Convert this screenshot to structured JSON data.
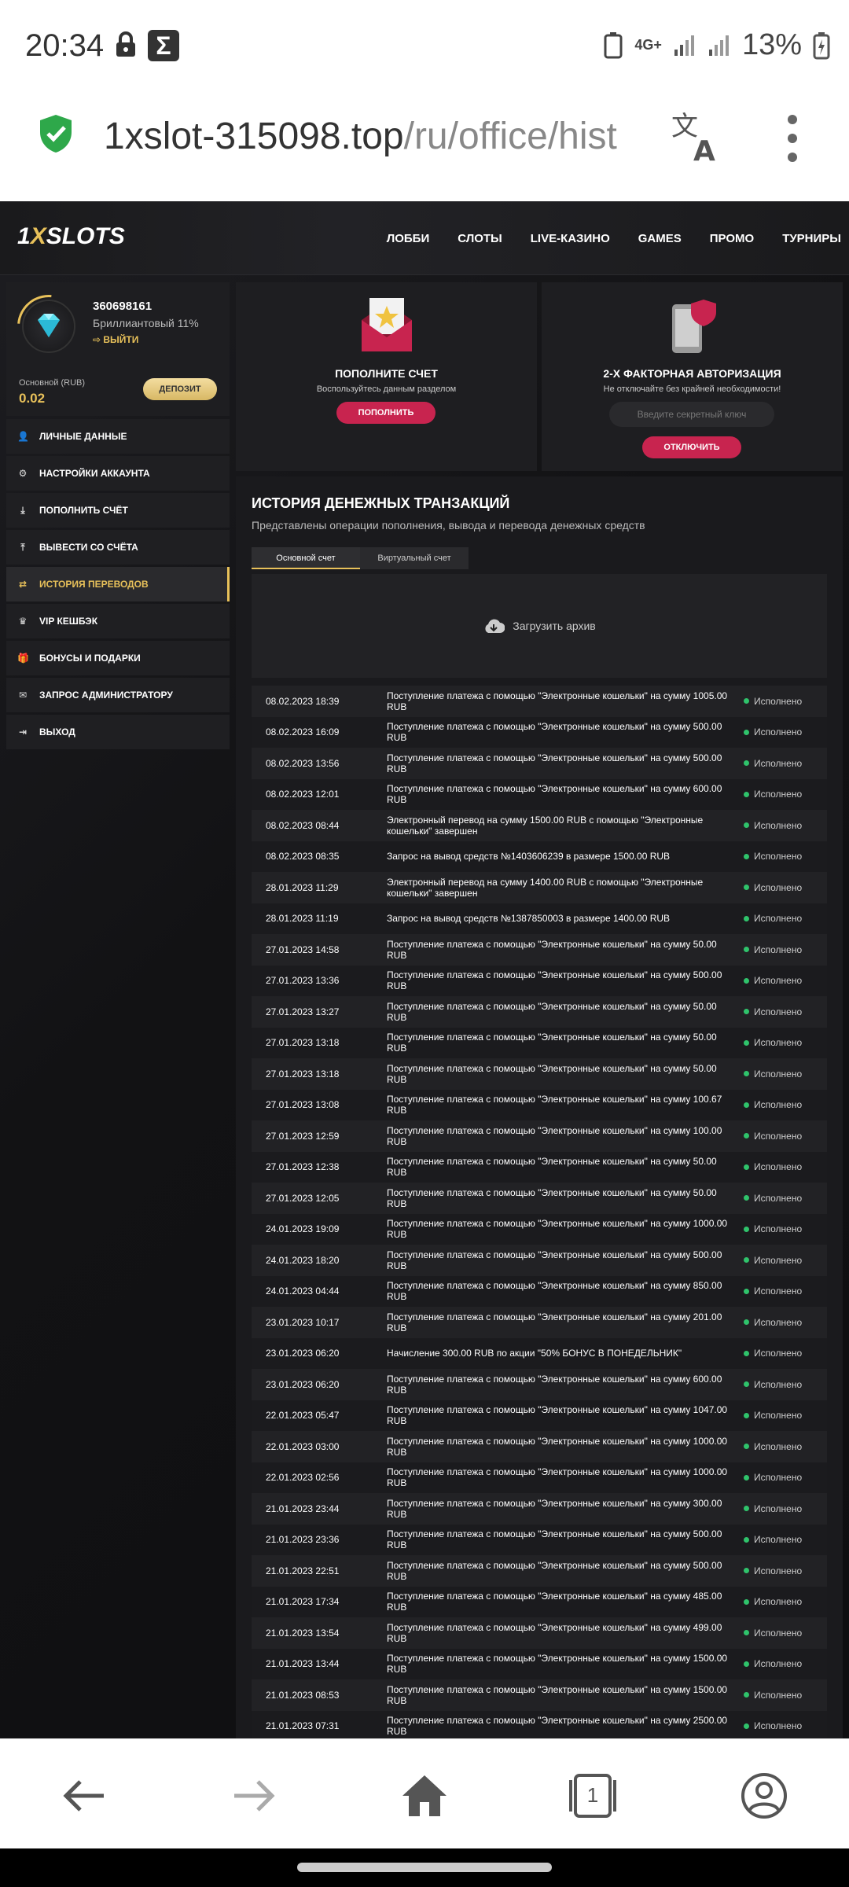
{
  "status": {
    "time": "20:34",
    "network": "4G+",
    "battery": "13%"
  },
  "browser": {
    "url_host": "1xslot-315098.top",
    "url_path": "/ru/office/hist",
    "tab_count": "1"
  },
  "site": {
    "logo_a": "1",
    "logo_x": "X",
    "logo_b": "SLOTS",
    "nav": [
      "ЛОББИ",
      "СЛОТЫ",
      "LIVE-КАЗИНО",
      "GAMES",
      "ПРОМО",
      "ТУРНИРЫ"
    ]
  },
  "profile": {
    "id": "360698161",
    "level": "Бриллиантовый 11%",
    "logout": "ВЫЙТИ",
    "balance_label": "Основной (RUB)",
    "balance": "0.02",
    "deposit_button": "ДЕПОЗИТ"
  },
  "sidebar": {
    "items": [
      {
        "label": "ЛИЧНЫЕ ДАННЫЕ",
        "icon": "user-plus-icon"
      },
      {
        "label": "НАСТРОЙКИ АККАУНТА",
        "icon": "gears-icon"
      },
      {
        "label": "ПОПОЛНИТЬ СЧЁТ",
        "icon": "download-icon"
      },
      {
        "label": "ВЫВЕСТИ СО СЧЁТА",
        "icon": "upload-icon"
      },
      {
        "label": "ИСТОРИЯ ПЕРЕВОДОВ",
        "icon": "transfer-icon",
        "active": true
      },
      {
        "label": "VIP КЕШБЭК",
        "icon": "crown-icon"
      },
      {
        "label": "БОНУСЫ И ПОДАРКИ",
        "icon": "gift-icon"
      },
      {
        "label": "ЗАПРОС АДМИНИСТРАТОРУ",
        "icon": "mail-icon"
      },
      {
        "label": "ВЫХОД",
        "icon": "exit-icon"
      }
    ]
  },
  "cards": {
    "deposit": {
      "title": "ПОПОЛНИТЕ СЧЕТ",
      "subtitle": "Воспользуйтесь данным разделом",
      "button": "ПОПОЛНИТЬ"
    },
    "twofa": {
      "title": "2-Х ФАКТОРНАЯ АВТОРИЗАЦИЯ",
      "subtitle": "Не отключайте без крайней необходимости!",
      "placeholder": "Введите секретный ключ",
      "button": "ОТКЛЮЧИТЬ"
    }
  },
  "history": {
    "title": "ИСТОРИЯ ДЕНЕЖНЫХ ТРАНЗАКЦИЙ",
    "subtitle": "Представлены операции пополнения, вывода и перевода денежных средств",
    "tabs": [
      "Основной счет",
      "Виртуальный счет"
    ],
    "archive": "Загрузить архив",
    "status_text": "Исполнено",
    "rows": [
      [
        "08.02.2023 18:39",
        "Поступление платежа с помощью \"Электронные кошельки\" на сумму 1005.00 RUB"
      ],
      [
        "08.02.2023 16:09",
        "Поступление платежа с помощью \"Электронные кошельки\" на сумму 500.00 RUB"
      ],
      [
        "08.02.2023 13:56",
        "Поступление платежа с помощью \"Электронные кошельки\" на сумму 500.00 RUB"
      ],
      [
        "08.02.2023 12:01",
        "Поступление платежа с помощью \"Электронные кошельки\" на сумму 600.00 RUB"
      ],
      [
        "08.02.2023 08:44",
        "Электронный перевод на сумму 1500.00 RUB с помощью \"Электронные кошельки\" завершен"
      ],
      [
        "08.02.2023 08:35",
        "Запрос на вывод средств №1403606239 в размере 1500.00 RUB"
      ],
      [
        "28.01.2023 11:29",
        "Электронный перевод на сумму 1400.00 RUB с помощью \"Электронные кошельки\" завершен"
      ],
      [
        "28.01.2023 11:19",
        "Запрос на вывод средств №1387850003 в размере 1400.00 RUB"
      ],
      [
        "27.01.2023 14:58",
        "Поступление платежа с помощью \"Электронные кошельки\" на сумму 50.00 RUB"
      ],
      [
        "27.01.2023 13:36",
        "Поступление платежа с помощью \"Электронные кошельки\" на сумму 500.00 RUB"
      ],
      [
        "27.01.2023 13:27",
        "Поступление платежа с помощью \"Электронные кошельки\" на сумму 50.00 RUB"
      ],
      [
        "27.01.2023 13:18",
        "Поступление платежа с помощью \"Электронные кошельки\" на сумму 50.00 RUB"
      ],
      [
        "27.01.2023 13:18",
        "Поступление платежа с помощью \"Электронные кошельки\" на сумму 50.00 RUB"
      ],
      [
        "27.01.2023 13:08",
        "Поступление платежа с помощью \"Электронные кошельки\" на сумму 100.67 RUB"
      ],
      [
        "27.01.2023 12:59",
        "Поступление платежа с помощью \"Электронные кошельки\" на сумму 100.00 RUB"
      ],
      [
        "27.01.2023 12:38",
        "Поступление платежа с помощью \"Электронные кошельки\" на сумму 50.00 RUB"
      ],
      [
        "27.01.2023 12:05",
        "Поступление платежа с помощью \"Электронные кошельки\" на сумму 50.00 RUB"
      ],
      [
        "24.01.2023 19:09",
        "Поступление платежа с помощью \"Электронные кошельки\" на сумму 1000.00 RUB"
      ],
      [
        "24.01.2023 18:20",
        "Поступление платежа с помощью \"Электронные кошельки\" на сумму 500.00 RUB"
      ],
      [
        "24.01.2023 04:44",
        "Поступление платежа с помощью \"Электронные кошельки\" на сумму 850.00 RUB"
      ],
      [
        "23.01.2023 10:17",
        "Поступление платежа с помощью \"Электронные кошельки\" на сумму 201.00 RUB"
      ],
      [
        "23.01.2023 06:20",
        "Начисление 300.00 RUB по акции \"50% БОНУС В ПОНЕДЕЛЬНИК\""
      ],
      [
        "23.01.2023 06:20",
        "Поступление платежа с помощью \"Электронные кошельки\" на сумму 600.00 RUB"
      ],
      [
        "22.01.2023 05:47",
        "Поступление платежа с помощью \"Электронные кошельки\" на сумму 1047.00 RUB"
      ],
      [
        "22.01.2023 03:00",
        "Поступление платежа с помощью \"Электронные кошельки\" на сумму 1000.00 RUB"
      ],
      [
        "22.01.2023 02:56",
        "Поступление платежа с помощью \"Электронные кошельки\" на сумму 1000.00 RUB"
      ],
      [
        "21.01.2023 23:44",
        "Поступление платежа с помощью \"Электронные кошельки\" на сумму 300.00 RUB"
      ],
      [
        "21.01.2023 23:36",
        "Поступление платежа с помощью \"Электронные кошельки\" на сумму 500.00 RUB"
      ],
      [
        "21.01.2023 22:51",
        "Поступление платежа с помощью \"Электронные кошельки\" на сумму 500.00 RUB"
      ],
      [
        "21.01.2023 17:34",
        "Поступление платежа с помощью \"Электронные кошельки\" на сумму 485.00 RUB"
      ],
      [
        "21.01.2023 13:54",
        "Поступление платежа с помощью \"Электронные кошельки\" на сумму 499.00 RUB"
      ],
      [
        "21.01.2023 13:44",
        "Поступление платежа с помощью \"Электронные кошельки\" на сумму 1500.00 RUB"
      ],
      [
        "21.01.2023 08:53",
        "Поступление платежа с помощью \"Электронные кошельки\" на сумму 1500.00 RUB"
      ],
      [
        "21.01.2023 07:31",
        "Поступление платежа с помощью \"Электронные кошельки\" на сумму 2500.00 RUB"
      ]
    ]
  },
  "colors": {
    "accent_gold": "#e8c15a",
    "button_pink": "#c8244f",
    "status_green": "#2fc36b"
  }
}
